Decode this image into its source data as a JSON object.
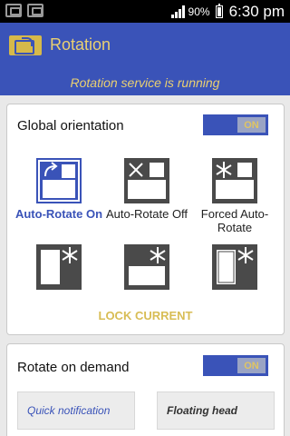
{
  "status_bar": {
    "battery": "90%",
    "time": "6:30 pm"
  },
  "header": {
    "title": "Rotation",
    "status_message": "Rotation service is running"
  },
  "global_orientation": {
    "title": "Global orientation",
    "toggle": "ON",
    "options": [
      {
        "label": "Auto-Rotate On",
        "icon": "auto-rotate-on-icon",
        "selected": true
      },
      {
        "label": "Auto-Rotate Off",
        "icon": "auto-rotate-off-icon",
        "selected": false
      },
      {
        "label": "Forced Auto-Rotate",
        "icon": "forced-auto-rotate-icon",
        "selected": false
      }
    ],
    "locks": [
      {
        "icon": "lock-portrait-icon"
      },
      {
        "icon": "lock-landscape-icon"
      },
      {
        "icon": "lock-reverse-icon"
      }
    ],
    "lock_current": "LOCK CURRENT"
  },
  "rotate_on_demand": {
    "title": "Rotate on demand",
    "toggle": "ON",
    "buttons": {
      "quick": "Quick notification",
      "floating": "Floating head"
    }
  },
  "colors": {
    "accent": "#3a53b8",
    "highlight": "#ead071",
    "icon_dark": "#4a4a4a"
  }
}
